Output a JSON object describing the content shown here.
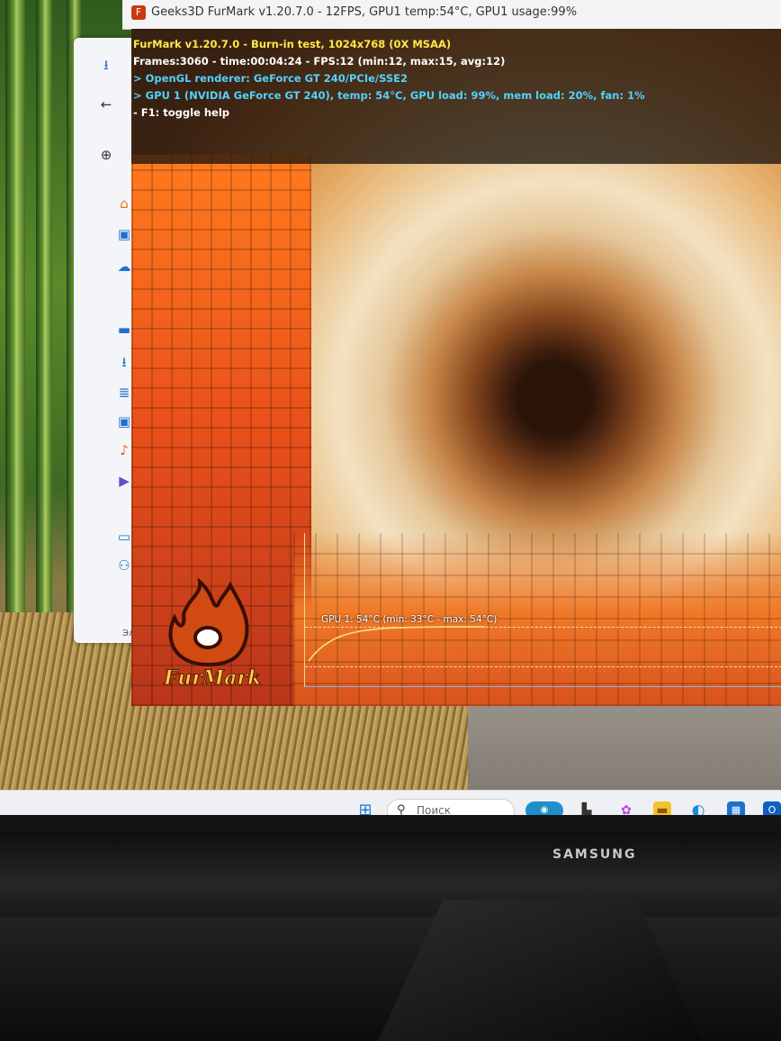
{
  "window": {
    "title": "Geeks3D FurMark v1.20.7.0 - 12FPS, GPU1 temp:54°C, GPU1 usage:99%",
    "app_icon": "furmark-icon"
  },
  "hud": {
    "line1": "FurMark v1.20.7.0 - Burn-in test, 1024x768 (0X MSAA)",
    "line2": "Frames:3060 - time:00:04:24 - FPS:12 (min:12, max:15, avg:12)",
    "line3": "> OpenGL renderer: GeForce GT 240/PCIe/SSE2",
    "line4": "> GPU 1 (NVIDIA GeForce GT 240), temp: 54°C, GPU load: 99%, mem load: 20%, fan: 1%",
    "line5": "- F1: toggle help"
  },
  "graph": {
    "label": "GPU 1: 54°C (min: 33°C - max: 54°C)",
    "current_temp_c": 54,
    "min_temp_c": 33,
    "max_temp_c": 54
  },
  "logo": {
    "text": "FurMark"
  },
  "explorer": {
    "statusbar": "Элеме"
  },
  "taskbar": {
    "search_placeholder": "Поиск"
  },
  "monitor": {
    "brand": "SAMSUNG"
  }
}
